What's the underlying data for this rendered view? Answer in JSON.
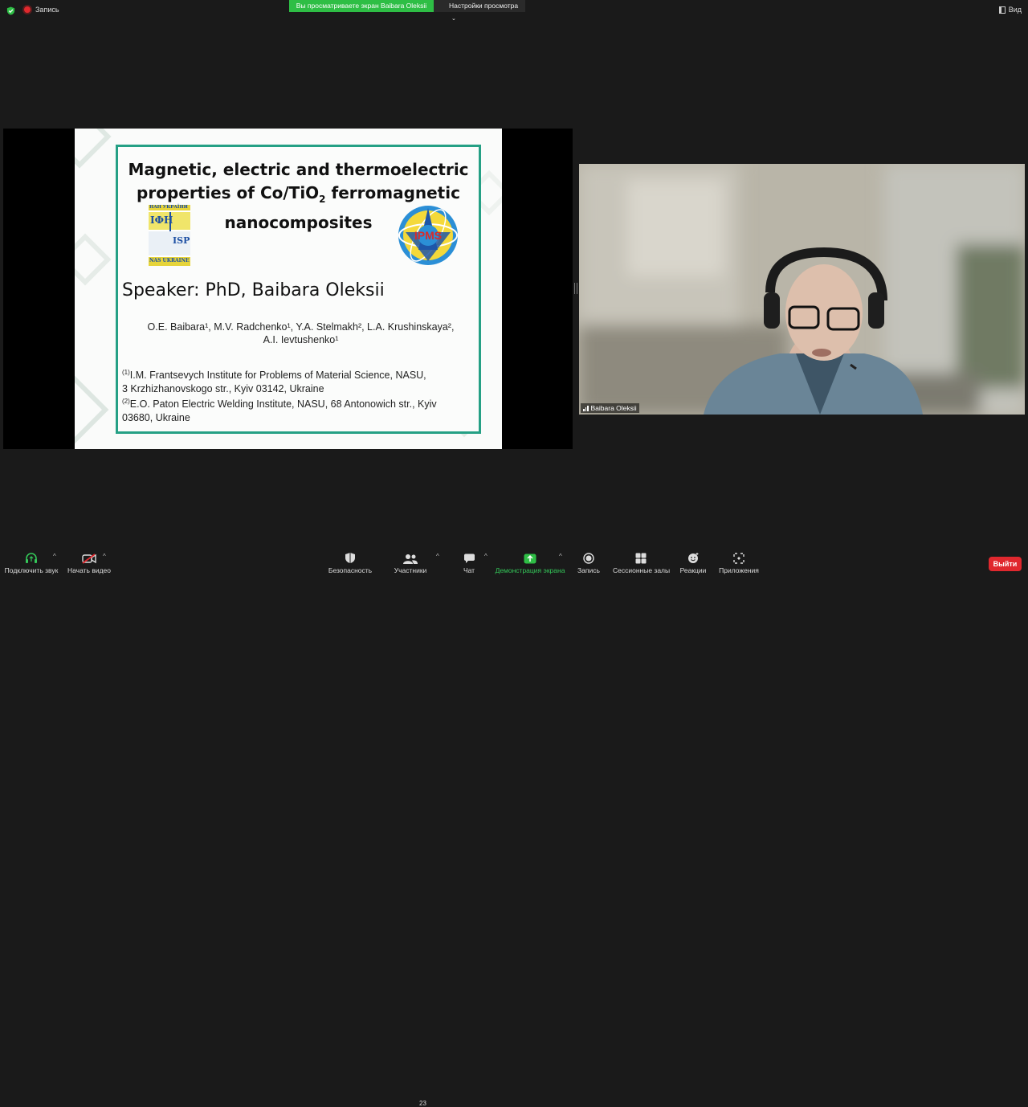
{
  "topbar": {
    "recording_label": "Запись",
    "share_banner": "Вы просматриваете экран Baibara Oleksii",
    "view_settings": "Настройки просмотра",
    "view_label": "Вид"
  },
  "slide": {
    "title_line1": "Magnetic, electric and thermoelectric",
    "title_line2_a": "properties of Co/TiO",
    "title_line2_sub": "2",
    "title_line2_b": " ferromagnetic",
    "title_line3": "nanocomposites",
    "logo_left": {
      "top": "НАН УКРАЇНИ",
      "mid": "ІФН",
      "right": "ISP",
      "bottom": "NAS UKRAINE"
    },
    "logo_right": {
      "text": "IPMS"
    },
    "speaker": "Speaker: PhD, Baibara Oleksii",
    "authors_line1": "O.E. Baibara¹, M.V. Radchenko¹, Y.A. Stelmakh², L.A. Krushinskaya²,",
    "authors_line2": "A.I. Ievtushenko¹",
    "affil1_mark": "(1)",
    "affil1_a": "I.M. Frantsevych Institute for Problems of Material Science, NASU,",
    "affil1_b": "3 Krzhizhanovskogo str., Kyiv 03142, Ukraine",
    "affil2_mark": "(2)",
    "affil2_a": "E.O. Paton Electric Welding Institute, NASU, 68 Antonowich str., Kyiv",
    "affil2_b": "03680, Ukraine"
  },
  "video": {
    "participant_name": "Baibara Oleksii"
  },
  "toolbar": {
    "audio": "Подключить звук",
    "video": "Начать видео",
    "security": "Безопасность",
    "participants": "Участники",
    "participants_count": "23",
    "chat": "Чат",
    "share": "Демонстрация экрана",
    "record": "Запись",
    "breakout": "Сессионные залы",
    "reactions": "Реакции",
    "apps": "Приложения",
    "exit": "Выйти"
  },
  "colors": {
    "share_green": "#2ebe45",
    "exit_red": "#e0282e",
    "slide_frame": "#25a085"
  }
}
